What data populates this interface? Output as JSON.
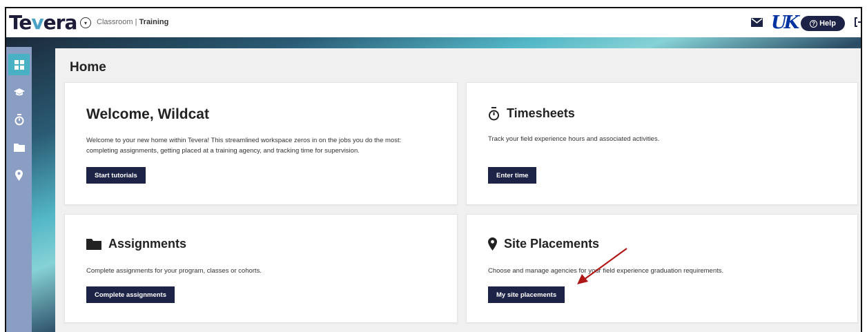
{
  "topbar": {
    "logo_prefix": "Te",
    "logo_v": "v",
    "logo_suffix": "era",
    "crumb_left": "Classroom | ",
    "crumb_right": "Training",
    "help_label": "Help"
  },
  "icons": {
    "toggle": "chevron-down-icon",
    "mail": "mail-icon",
    "uk": "uk-logo",
    "help": "question-circle-icon",
    "logout": "logout-icon",
    "sidebar": [
      "dashboard-grid-icon",
      "graduation-cap-icon",
      "stopwatch-icon",
      "folder-icon",
      "map-pin-icon"
    ]
  },
  "main": {
    "title": "Home"
  },
  "cards": {
    "welcome": {
      "title": "Welcome, Wildcat",
      "desc_line1": "Welcome to your new home within Tevera! This streamlined workspace zeros in on the jobs you do the most:",
      "desc_line2": "completing assignments, getting placed at a training agency, and tracking time for supervision.",
      "button": "Start tutorials"
    },
    "timesheets": {
      "title": "Timesheets",
      "desc": "Track your field experience hours and associated activities.",
      "button": "Enter time"
    },
    "assignments": {
      "title": "Assignments",
      "desc": "Complete assignments for your program, classes or cohorts.",
      "button": "Complete assignments"
    },
    "placements": {
      "title": "Site Placements",
      "desc": "Choose and manage agencies for your field experience graduation requirements.",
      "button": "My site placements"
    }
  },
  "colors": {
    "navy": "#1d2346",
    "sidebar": "#8a9dc2",
    "sidebar_active": "#48b2c4",
    "arrow": "#b01818"
  }
}
